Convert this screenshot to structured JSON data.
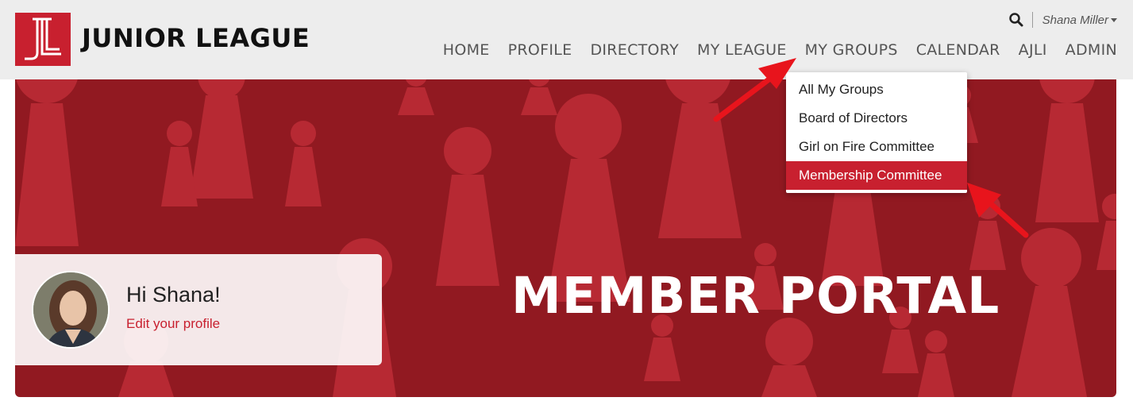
{
  "header": {
    "brand": "JUNIOR LEAGUE",
    "user_name": "Shana Miller",
    "nav": [
      {
        "label": "HOME"
      },
      {
        "label": "PROFILE"
      },
      {
        "label": "DIRECTORY"
      },
      {
        "label": "MY LEAGUE"
      },
      {
        "label": "MY GROUPS"
      },
      {
        "label": "CALENDAR"
      },
      {
        "label": "AJLI"
      },
      {
        "label": "ADMIN"
      }
    ]
  },
  "dropdown": {
    "items": [
      {
        "label": "All My Groups"
      },
      {
        "label": "Board of Directors"
      },
      {
        "label": "Girl on Fire Committee"
      },
      {
        "label": "Membership Committee"
      }
    ],
    "active_index": 3
  },
  "hero": {
    "title": "MEMBER PORTAL",
    "greeting": "Hi Shana!",
    "edit_link": "Edit your profile"
  },
  "colors": {
    "brand_red": "#c8202f",
    "hero_bg": "#911921",
    "header_bg": "#ededed"
  }
}
